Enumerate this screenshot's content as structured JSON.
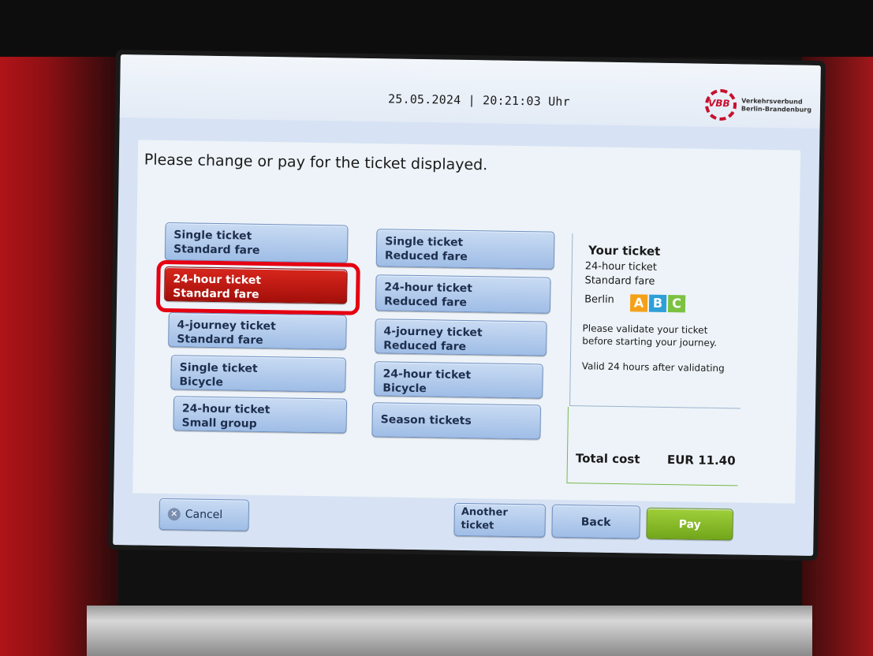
{
  "header": {
    "datetime": "25.05.2024 | 20:21:03 Uhr",
    "logo": {
      "abbr": "VBB",
      "line1": "Verkehrsverbund",
      "line2": "Berlin-Brandenburg"
    }
  },
  "instruction": "Please change or pay for the ticket displayed.",
  "tickets_left": [
    {
      "line1": "Single ticket",
      "line2": "Standard fare",
      "selected": false
    },
    {
      "line1": "24-hour ticket",
      "line2": "Standard fare",
      "selected": true
    },
    {
      "line1": "4-journey ticket",
      "line2": "Standard fare",
      "selected": false
    },
    {
      "line1": "Single ticket",
      "line2": "Bicycle",
      "selected": false
    },
    {
      "line1": "24-hour ticket",
      "line2": "Small group",
      "selected": false
    }
  ],
  "tickets_right": [
    {
      "line1": "Single ticket",
      "line2": "Reduced fare"
    },
    {
      "line1": "24-hour ticket",
      "line2": "Reduced fare"
    },
    {
      "line1": "4-journey ticket",
      "line2": "Reduced fare"
    },
    {
      "line1": "24-hour ticket",
      "line2": "Bicycle"
    },
    {
      "line1": "Season tickets",
      "line2": ""
    }
  ],
  "summary": {
    "title": "Your ticket",
    "ticket": "24-hour ticket",
    "fare": "Standard fare",
    "area": "Berlin",
    "zones": [
      "A",
      "B",
      "C"
    ],
    "note1": "Please validate your ticket",
    "note2": "before starting your journey.",
    "validity": "Valid 24 hours after validating"
  },
  "cost": {
    "label": "Total cost",
    "value": "EUR 11.40"
  },
  "footer": {
    "cancel": "Cancel",
    "another_line1": "Another",
    "another_line2": "ticket",
    "back": "Back",
    "pay": "Pay"
  },
  "colors": {
    "selected": "#c8160f",
    "highlight": "#e50012",
    "pay": "#86b92a",
    "button": "#b3cdee"
  }
}
